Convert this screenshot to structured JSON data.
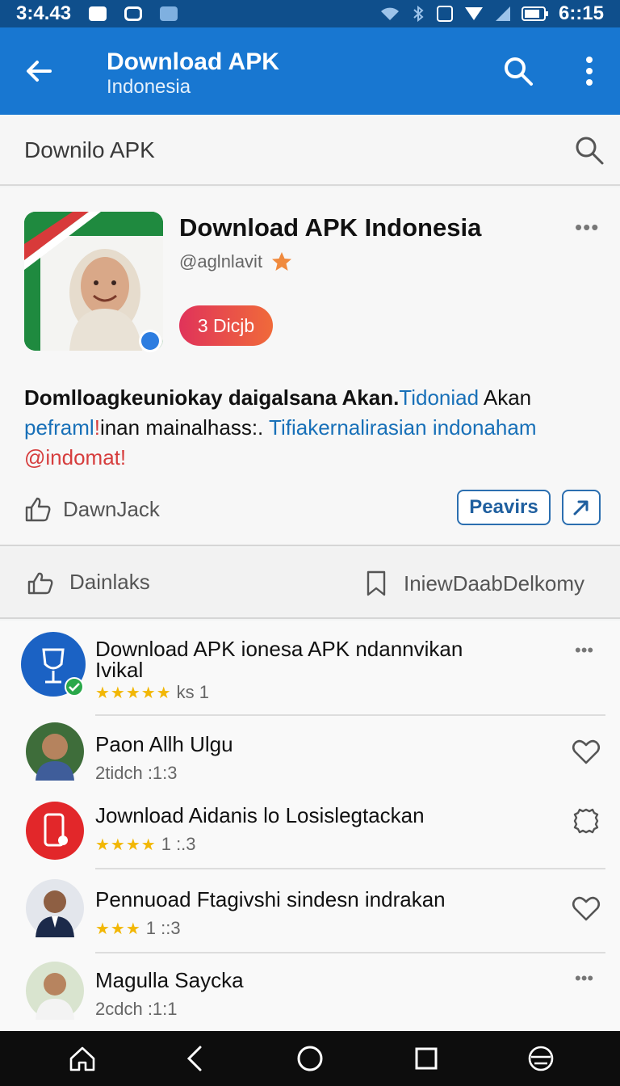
{
  "status": {
    "time_left": "3:4.43",
    "time_right": "6::15"
  },
  "appbar": {
    "title": "Download APK",
    "subtitle": "Indonesia"
  },
  "search": {
    "text": "Downilo APK"
  },
  "profile": {
    "name": "Download APK Indonesia",
    "handle": "@aglnlavit",
    "pill_label": "3 Dicjb",
    "desc_black_1": "Domlloagkeuniokay daigalsana Akan.",
    "desc_link_1": "Tidoniad",
    "desc_black_2": "Akan",
    "desc_link_2": "peframl",
    "desc_red_1": "!",
    "desc_black_3": "inan mainalhass:.",
    "desc_link_3": "Tifiakernalirasian indonaham",
    "desc_red_2": "@indomat!",
    "like_label": "DawnJack",
    "review_button": "Peavirs"
  },
  "tabs": {
    "left_label": "Dainlaks",
    "right_label": "IniewDaabDelkomy"
  },
  "list": [
    {
      "title": "Download APK ionesa APK ndannvikan",
      "title2": "Ivikal",
      "meta": "ks 1",
      "stars": "★★★★★",
      "trail": "more"
    },
    {
      "title": "Paon Allh Ulgu",
      "meta": "2tidch :1:3",
      "stars": "",
      "trail": "heart"
    },
    {
      "title": "Jownload Aidanis lo Losislegtackan",
      "meta": "1 :.3",
      "stars": "★★★★",
      "trail": "gear"
    },
    {
      "title": "Pennuoad Ftagivshi sindesn indrakan",
      "meta": "1 ::3",
      "stars": "★★★",
      "trail": "heart"
    },
    {
      "title": "Magulla Saycka",
      "meta": "2cdch :1:1",
      "stars": "",
      "trail": "more"
    }
  ],
  "colors": {
    "appbar": "#1877d1",
    "status": "#0f4f8c",
    "accent": "#1870b8",
    "pill_start": "#e0335a",
    "pill_end": "#f06a3a"
  }
}
